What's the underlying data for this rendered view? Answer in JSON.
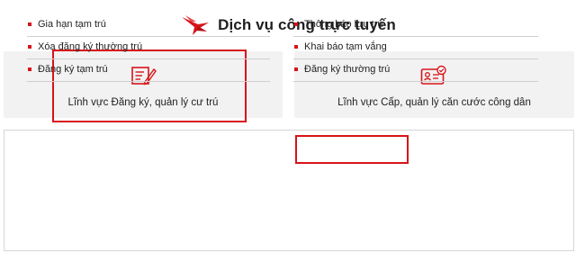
{
  "header": {
    "title": "Dịch vụ công trực tuyến",
    "logo_icon": "red-bird-logo"
  },
  "cards": [
    {
      "label": "Lĩnh vực Đăng ký, quản lý cư trú",
      "icon": "document-pen-icon",
      "highlighted": true
    },
    {
      "label": "Lĩnh vực Cấp, quản lý căn cước công dân",
      "icon": "id-card-icon",
      "highlighted": false
    }
  ],
  "services": {
    "left": [
      "Gia hạn tạm trú",
      "Xóa đăng ký thường trú",
      "Đăng ký tạm trú"
    ],
    "right": [
      "Thông báo lưu trú",
      "Khai báo tạm vắng",
      "Đăng ký thường trú"
    ],
    "highlighted_item": "Thông báo lưu trú"
  },
  "colors": {
    "accent": "#d7141a",
    "card_background": "#f2f2f2",
    "text": "#222222"
  }
}
